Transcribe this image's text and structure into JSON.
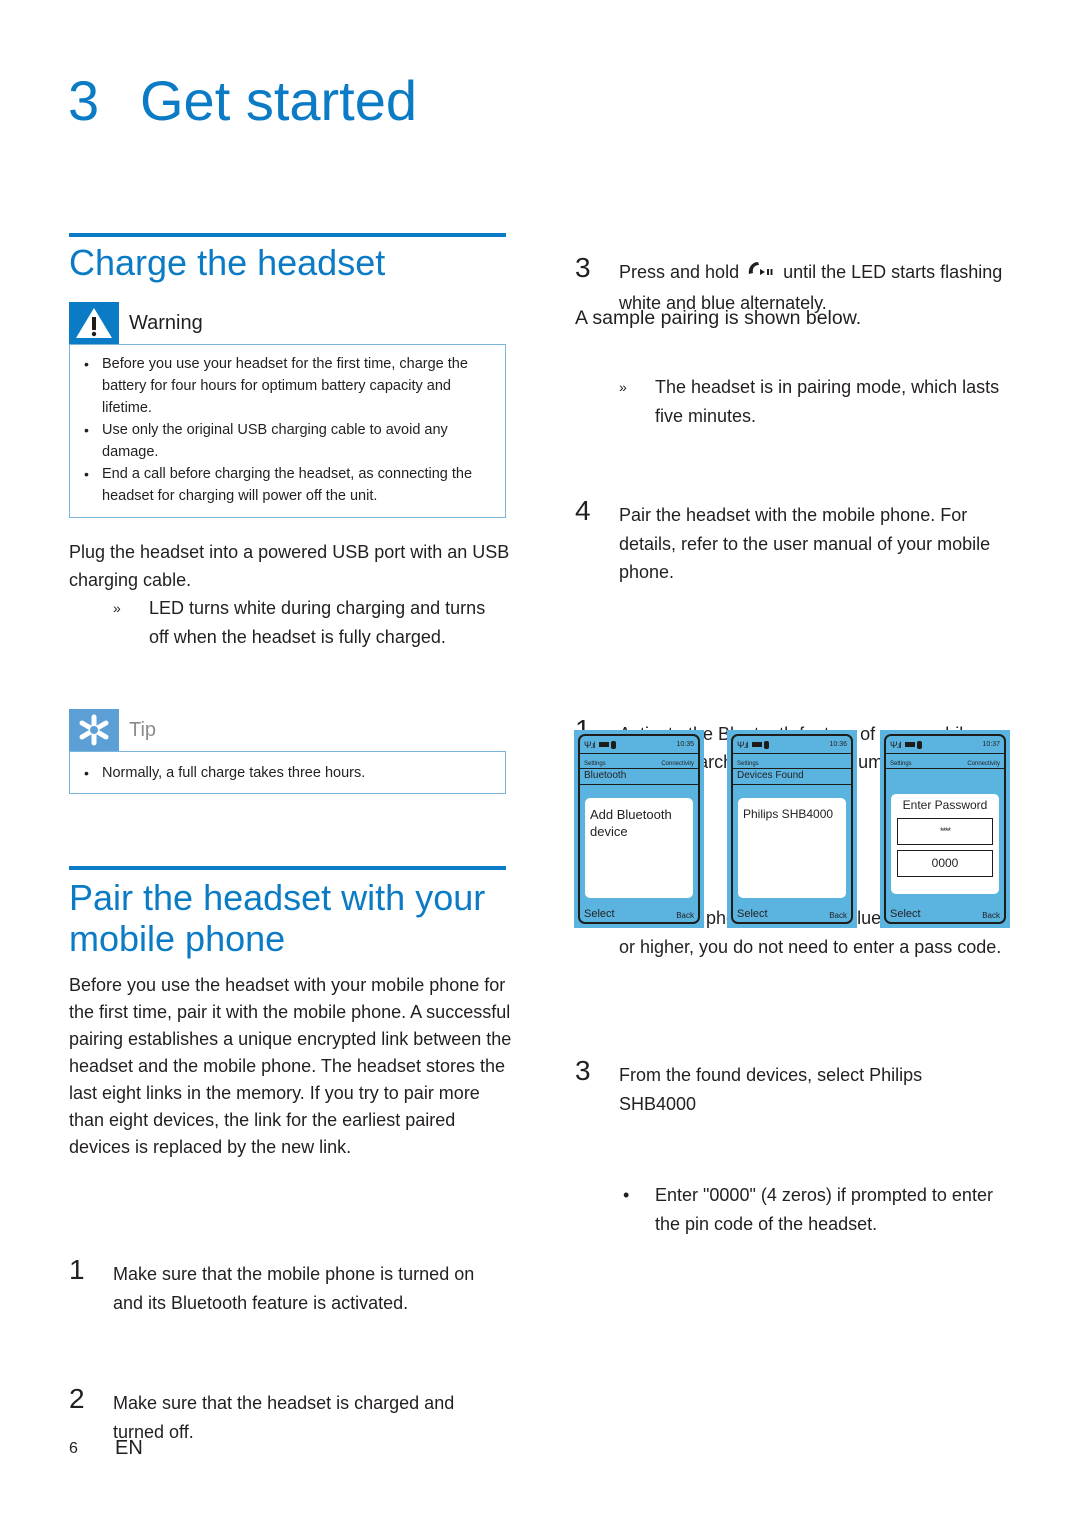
{
  "chapter": {
    "number": "3",
    "title": "Get started"
  },
  "colors": {
    "accent": "#0a7bc4",
    "tip_accent": "#5b9fd6",
    "phone_bg": "#5bb4e0"
  },
  "charge_section": {
    "heading": "Charge the headset",
    "warning": {
      "icon": "warning-triangle-icon",
      "label": "Warning",
      "items": [
        "Before you use your headset for the first time, charge the battery for four hours for optimum battery capacity and lifetime.",
        "Use only the original USB charging cable to avoid any damage.",
        "End a call before charging the headset, as connecting the headset for charging will power off the unit."
      ]
    },
    "instruction": "Plug the headset into a powered USB port with an USB charging cable.",
    "result_mark": "»",
    "result": "LED turns white during charging and turns off when the headset is fully charged.",
    "tip": {
      "icon": "tip-asterisk-icon",
      "label": "Tip",
      "items": [
        "Normally, a full charge takes three hours."
      ]
    }
  },
  "pair_section": {
    "heading": "Pair the headset with your mobile phone",
    "intro": "Before you use the headset with your mobile phone for the first time, pair it with the mobile phone. A successful pairing establishes a unique encrypted link between the headset and the mobile phone. The headset stores the last eight links in the memory. If you try to pair more than eight devices, the link for the earliest paired devices is replaced by the new link.",
    "steps": [
      {
        "n": "1",
        "text": "Make sure that the mobile phone is turned on and its Bluetooth feature is activated."
      },
      {
        "n": "2",
        "text": "Make sure that the headset is charged and turned off."
      },
      {
        "n": "3",
        "text_before": "Press and hold",
        "button_icon": "call-play-pause-icon",
        "text_after": "until the LED starts flashing white and blue alternately.",
        "result_mark": "»",
        "result": "The headset is in pairing mode, which lasts five minutes."
      },
      {
        "n": "4",
        "text": "Pair the headset with the mobile phone. For details, refer to the user manual of your mobile phone."
      }
    ],
    "sample_intro": "A sample pairing is shown below.",
    "sample_steps": [
      {
        "n": "1",
        "text": "Activate the Bluetooth feature of your mobile phone, search for the model number of the headset."
      },
      {
        "n": "2",
        "text": "On mobile phones featuring Bluetooth 2.1+EDR or higher, you do not need to enter a pass code."
      },
      {
        "n": "3",
        "text": "From the found devices, select Philips SHB4000",
        "bullet_mark": "•",
        "bullet": "Enter \"0000\" (4 zeros) if prompted to enter the pin code of the headset."
      }
    ]
  },
  "phones": [
    {
      "time": "10:35",
      "crumb_left": "Settings",
      "crumb_right": "Connectivity",
      "title": "Bluetooth",
      "content": "Add Bluetooth device",
      "soft_left": "Select",
      "soft_right": "Back"
    },
    {
      "time": "10:36",
      "crumb_left": "Settings",
      "crumb_right": "",
      "title": "Devices Found",
      "content": "Philips SHB4000",
      "soft_left": "Select",
      "soft_right": "Back"
    },
    {
      "time": "10:37",
      "crumb_left": "Settings",
      "crumb_right": "Connectivity",
      "title": "",
      "prompt": "Enter Password",
      "masked": "****",
      "value": "0000",
      "soft_left": "Select",
      "soft_right": "Back"
    }
  ],
  "footer": {
    "page": "6",
    "lang": "EN"
  }
}
